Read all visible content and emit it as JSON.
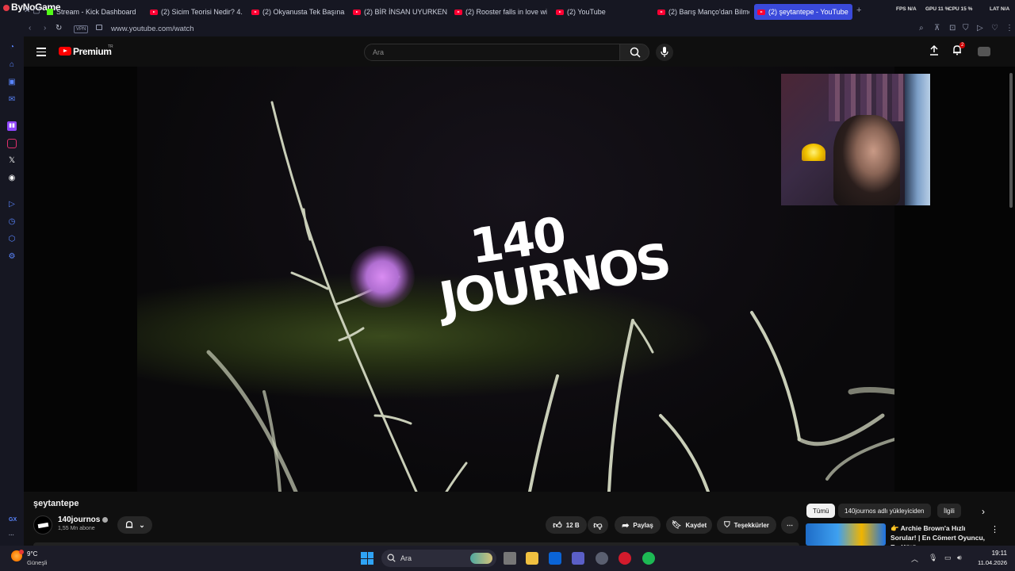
{
  "browser": {
    "brand": "ByNoGame",
    "tabs": [
      {
        "label": "Stream - Kick Dashboard",
        "icon": "kick-icon"
      },
      {
        "label": "(2) Sicim Teorisi Nedir? 4.",
        "icon": "youtube-icon"
      },
      {
        "label": "(2) Okyanusta Tek Başına",
        "icon": "youtube-icon"
      },
      {
        "label": "(2) BİR İNSAN UYURKEN",
        "icon": "youtube-icon"
      },
      {
        "label": "(2) Rooster falls in love wi",
        "icon": "youtube-icon"
      },
      {
        "label": "(2) YouTube",
        "icon": "youtube-icon"
      },
      {
        "label": "(2) Barış Manço'dan Bilme",
        "icon": "youtube-icon"
      },
      {
        "label": "(2) şeytantepe - YouTube",
        "icon": "youtube-icon",
        "active": true
      }
    ],
    "stats": {
      "fps": "FPS N/A",
      "gpu": "GPU 11 %",
      "cpu": "CPU 15 %",
      "lat": "LAT N/A"
    },
    "vpn_label": "VPN",
    "url": "www.youtube.com/watch",
    "sidebar_bottom_label": "GX",
    "sidebar_more": "···"
  },
  "youtube": {
    "logo_text": "Premium",
    "region": "TR",
    "search_placeholder": "Ara",
    "notification_count": "2",
    "video_title_art": {
      "line1": "140",
      "line2": "JOURNOS"
    },
    "video": {
      "title": "şeytantepe",
      "channel": "140journos",
      "subscribers": "1,55 Mn abone",
      "likes": "12 B",
      "share": "Paylaş",
      "save": "Kaydet",
      "thanks": "Teşekkürler"
    },
    "chips": [
      "Tümü",
      "140journos adlı yükleyiciden",
      "İlgili"
    ],
    "recommendation": {
      "title": "👉 Archie Brown'a Hızlı Sorular! | En Cömert Oyuncu, En Kötü ..."
    }
  },
  "taskbar": {
    "temperature": "9°C",
    "weather": "Güneşli",
    "search": "Ara",
    "time": "19:11",
    "date": "11.04.2026"
  },
  "colors": {
    "accent_tab": "#3a4adb",
    "youtube_red": "#ff0000",
    "sidebar_icon": "#5a86ff"
  }
}
